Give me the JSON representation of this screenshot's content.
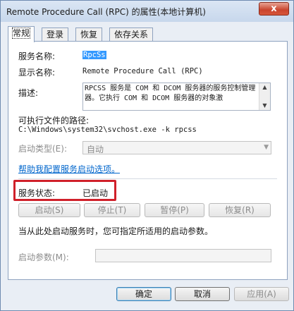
{
  "window": {
    "title": "Remote Procedure Call (RPC) 的属性(本地计算机)",
    "close_glyph": "x"
  },
  "tabs": [
    {
      "label": "常规",
      "active": true
    },
    {
      "label": "登录",
      "active": false
    },
    {
      "label": "恢复",
      "active": false
    },
    {
      "label": "依存关系",
      "active": false
    }
  ],
  "general": {
    "service_name_label": "服务名称:",
    "service_name_value": "RpcSs",
    "display_name_label": "显示名称:",
    "display_name_value": "Remote Procedure Call (RPC)",
    "description_label": "描述:",
    "description_value": "RPCSS 服务是 COM 和 DCOM 服务器的服务控制管理器。它执行 COM 和 DCOM 服务器的对象激",
    "exec_path_label": "可执行文件的路径:",
    "exec_path_value": "C:\\Windows\\system32\\svchost.exe -k rpcss",
    "startup_type_label": "启动类型(E):",
    "startup_type_value": "自动",
    "help_link": "帮助我配置服务启动选项。",
    "status_label": "服务状态:",
    "status_value": "已启动",
    "start_button": "启动(S)",
    "stop_button": "停止(T)",
    "pause_button": "暂停(P)",
    "resume_button": "恢复(R)",
    "hint_text": "当从此处启动服务时，您可指定所适用的启动参数。",
    "start_params_label": "启动参数(M):",
    "start_params_value": ""
  },
  "footer": {
    "ok": "确定",
    "cancel": "取消",
    "apply": "应用(A)"
  },
  "colors": {
    "highlight_border": "#d0202a",
    "link": "#0066cc",
    "selection": "#3399ff"
  }
}
